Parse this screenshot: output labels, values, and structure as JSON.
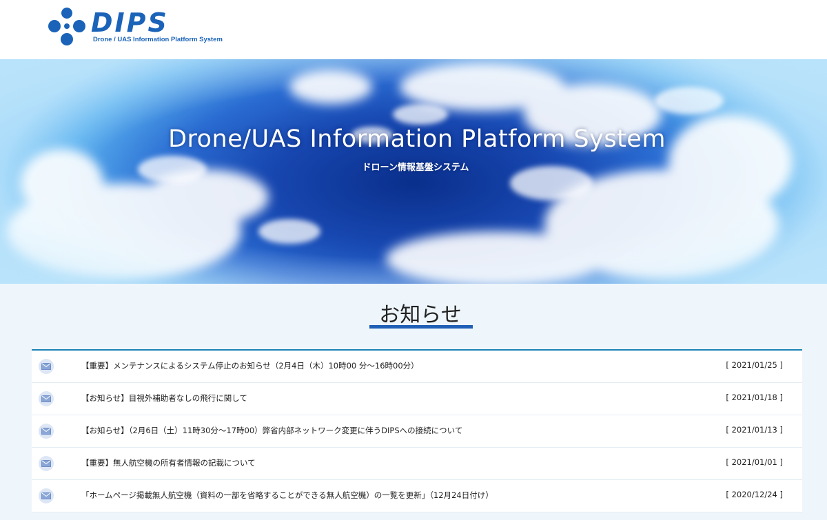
{
  "header": {
    "logo_text": "DIPS",
    "logo_subtext": "Drone / UAS Information Platform System",
    "brand_color": "#1a63b8"
  },
  "hero": {
    "title": "Drone/UAS Information Platform System",
    "subtitle": "ドローン情報基盤システム"
  },
  "notices": {
    "heading": "お知らせ",
    "icon": "mail-icon",
    "items": [
      {
        "title": "【重要】メンテナンスによるシステム停止のお知らせ（2月4日（木）10時00 分〜16時00分）",
        "date": "[ 2021/01/25 ]"
      },
      {
        "title": "【お知らせ】目視外補助者なしの飛行に関して",
        "date": "[ 2021/01/18 ]"
      },
      {
        "title": "【お知らせ】（2月6日（土）11時30分〜17時00）弊省内部ネットワーク変更に伴うDIPSへの接続について",
        "date": "[ 2021/01/13 ]"
      },
      {
        "title": "【重要】無人航空機の所有者情報の記載について",
        "date": "[ 2021/01/01 ]"
      },
      {
        "title": "「ホームページ掲載無人航空機（資料の一部を省略することができる無人航空機）の一覧を更新」（12月24日付け）",
        "date": "[ 2020/12/24 ]"
      }
    ]
  }
}
